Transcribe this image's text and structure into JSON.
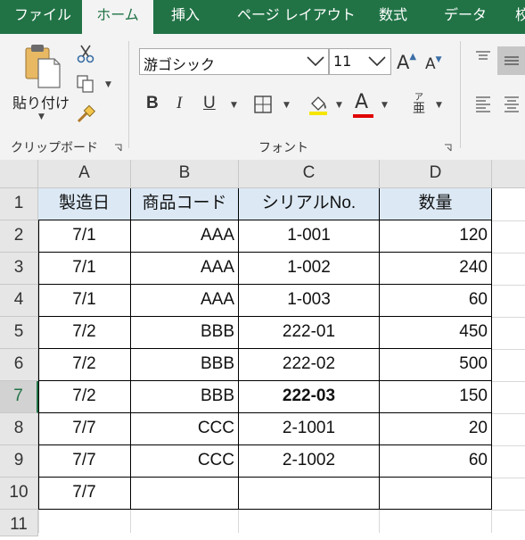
{
  "ribbon_tabs": [
    {
      "label": "ファイル",
      "active": false
    },
    {
      "label": "ホーム",
      "active": true
    },
    {
      "label": "挿入",
      "active": false
    },
    {
      "label": "ページ レイアウト",
      "active": false
    },
    {
      "label": "数式",
      "active": false
    },
    {
      "label": "データ",
      "active": false
    },
    {
      "label": "校",
      "active": false
    }
  ],
  "clipboard": {
    "paste_label": "貼り付け",
    "group_label": "クリップボード"
  },
  "font": {
    "name": "游ゴシック",
    "size": "11",
    "group_label": "フォント",
    "bold": "B",
    "italic": "I",
    "underline": "U",
    "grow": "A",
    "shrink": "A",
    "font_color_letter": "A",
    "phonetic": "ア",
    "font_color": "#e00000"
  },
  "columns": [
    "A",
    "B",
    "C",
    "D"
  ],
  "rows": [
    "1",
    "2",
    "3",
    "4",
    "5",
    "6",
    "7",
    "8",
    "9",
    "10",
    "11"
  ],
  "selected_row": "7",
  "table": {
    "headers": [
      "製造日",
      "商品コード",
      "シリアルNo.",
      "数量"
    ],
    "records": [
      {
        "date": "7/1",
        "code": "AAA",
        "serial": "1-001",
        "qty": "120"
      },
      {
        "date": "7/1",
        "code": "AAA",
        "serial": "1-002",
        "qty": "240"
      },
      {
        "date": "7/1",
        "code": "AAA",
        "serial": "1-003",
        "qty": "60"
      },
      {
        "date": "7/2",
        "code": "BBB",
        "serial": "222-01",
        "qty": "450"
      },
      {
        "date": "7/2",
        "code": "BBB",
        "serial": "222-02",
        "qty": "500"
      },
      {
        "date": "7/2",
        "code": "BBB",
        "serial": "222-03",
        "qty": "150"
      },
      {
        "date": "7/7",
        "code": "CCC",
        "serial": "2-1001",
        "qty": "20"
      },
      {
        "date": "7/7",
        "code": "CCC",
        "serial": "2-1002",
        "qty": "60"
      },
      {
        "date": "7/7",
        "code": "",
        "serial": "",
        "qty": ""
      }
    ]
  }
}
